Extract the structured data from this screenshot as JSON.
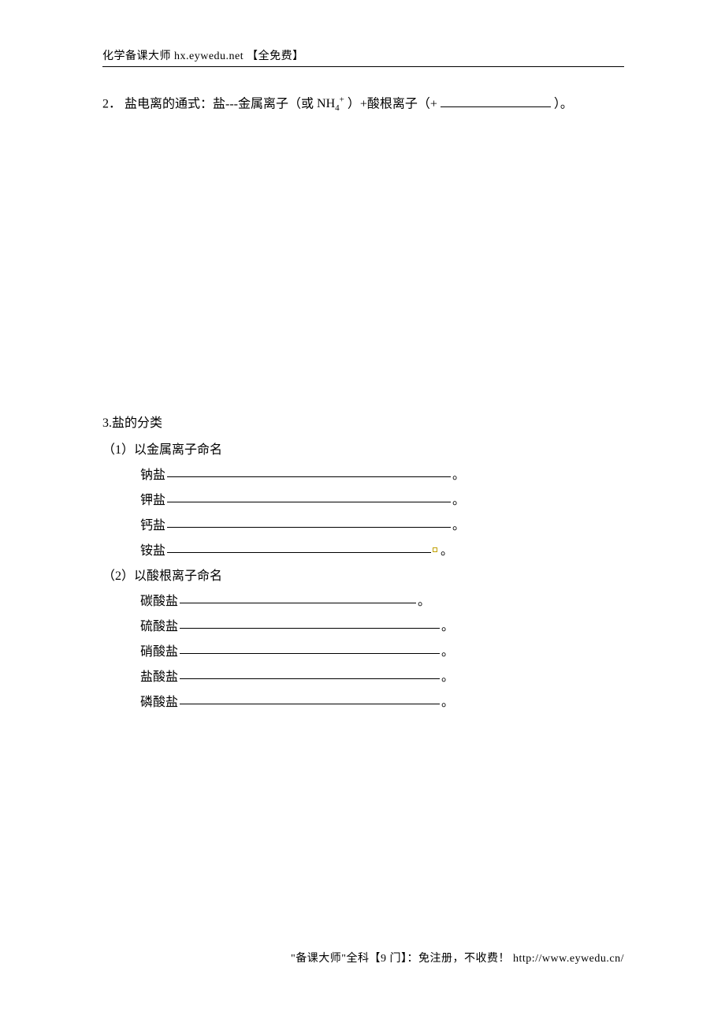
{
  "header": {
    "site_label": "化学备课大师",
    "site_url": "hx.eywedu.net",
    "tag": "【全免费】"
  },
  "footer": {
    "prefix": "\"备课大师\"全科【9 门】：免注册，不收费！",
    "url": "http://www.eywedu.cn/"
  },
  "q2": {
    "num": "2．",
    "prefix": "盐电离的通式：盐---金属离子（或",
    "nh4": "NH",
    "sub": "4",
    "sup": "+",
    "after_nh4": "）+酸根离子（+",
    "close": "）。"
  },
  "q3": {
    "head": "3.盐的分类",
    "sub1": "（1）以金属离子命名",
    "metal": {
      "na": "钠盐",
      "k": "钾盐",
      "ca": "钙盐",
      "nh4": "铵盐"
    },
    "sub2": "（2）以酸根离子命名",
    "anion": {
      "co3": "碳酸盐",
      "so4": "硫酸盐",
      "no3": "硝酸盐",
      "cl": "盐酸盐",
      "po4": "磷酸盐"
    },
    "punct": "。"
  }
}
